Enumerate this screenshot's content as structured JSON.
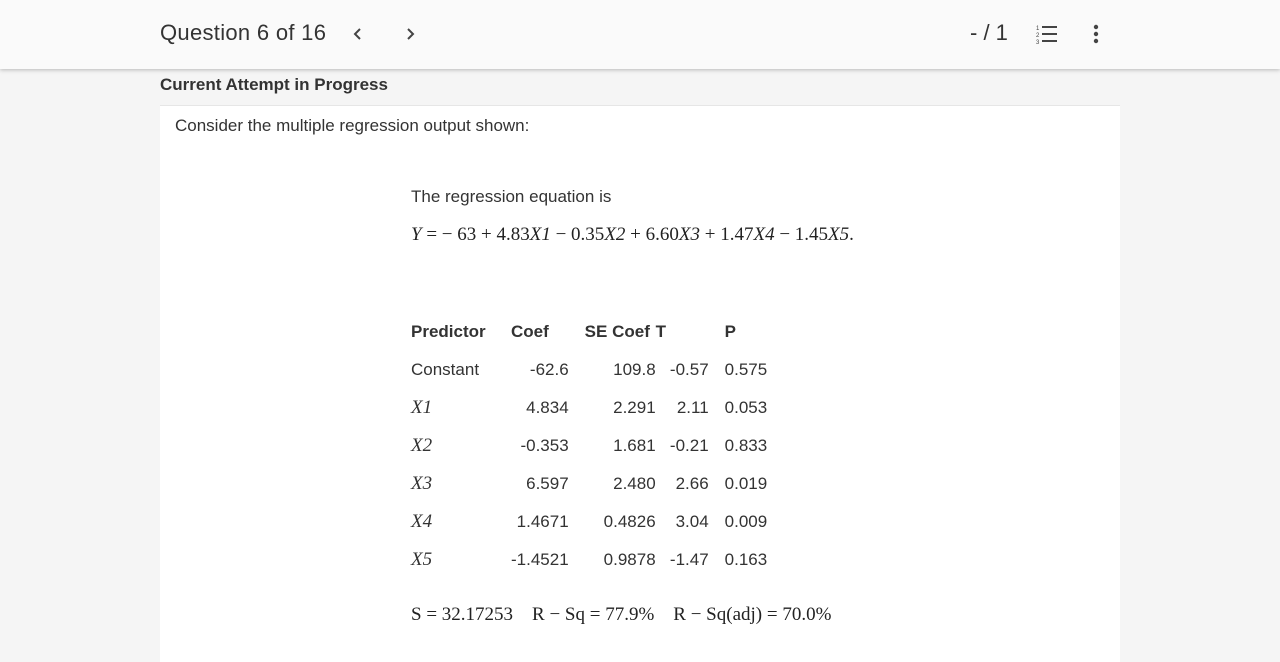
{
  "header": {
    "question_label": "Question 6 of 16",
    "score": "- / 1",
    "icons": {
      "prev": "chevron-left-icon",
      "next": "chevron-right-icon",
      "list": "numbered-list-icon",
      "more": "more-vertical-icon"
    }
  },
  "attempt_status": "Current Attempt in Progress",
  "question": {
    "prompt": "Consider the multiple regression output shown:",
    "equation_intro": "The regression equation is",
    "equation": {
      "lhs": "Y",
      "rhs_parts": [
        "− 63 + 4.83",
        "X1",
        " − 0.35",
        "X2",
        " + 6.60",
        "X3",
        " + 1.47",
        "X4",
        " − 1.45",
        "X5",
        "."
      ]
    },
    "table": {
      "headers": [
        "Predictor",
        "Coef",
        "SE Coef",
        "T",
        "P"
      ],
      "rows": [
        [
          "Constant",
          "-62.6",
          "109.8",
          "-0.57",
          "0.575"
        ],
        [
          "X1",
          "4.834",
          "2.291",
          "2.11",
          "0.053"
        ],
        [
          "X2",
          "-0.353",
          "1.681",
          "-0.21",
          "0.833"
        ],
        [
          "X3",
          "6.597",
          "2.480",
          "2.66",
          "0.019"
        ],
        [
          "X4",
          "1.4671",
          "0.4826",
          "3.04",
          "0.009"
        ],
        [
          "X5",
          "-1.4521",
          "0.9878",
          "-1.47",
          "0.163"
        ]
      ]
    },
    "stats": {
      "s": "S = 32.17253",
      "rsq": "R − Sq = 77.9%",
      "rsq_adj": "R − Sq(adj) = 70.0%"
    }
  },
  "colors": {
    "header_bg": "#fafafa",
    "page_bg": "#f5f5f5",
    "card_bg": "#ffffff",
    "text": "#333333"
  }
}
